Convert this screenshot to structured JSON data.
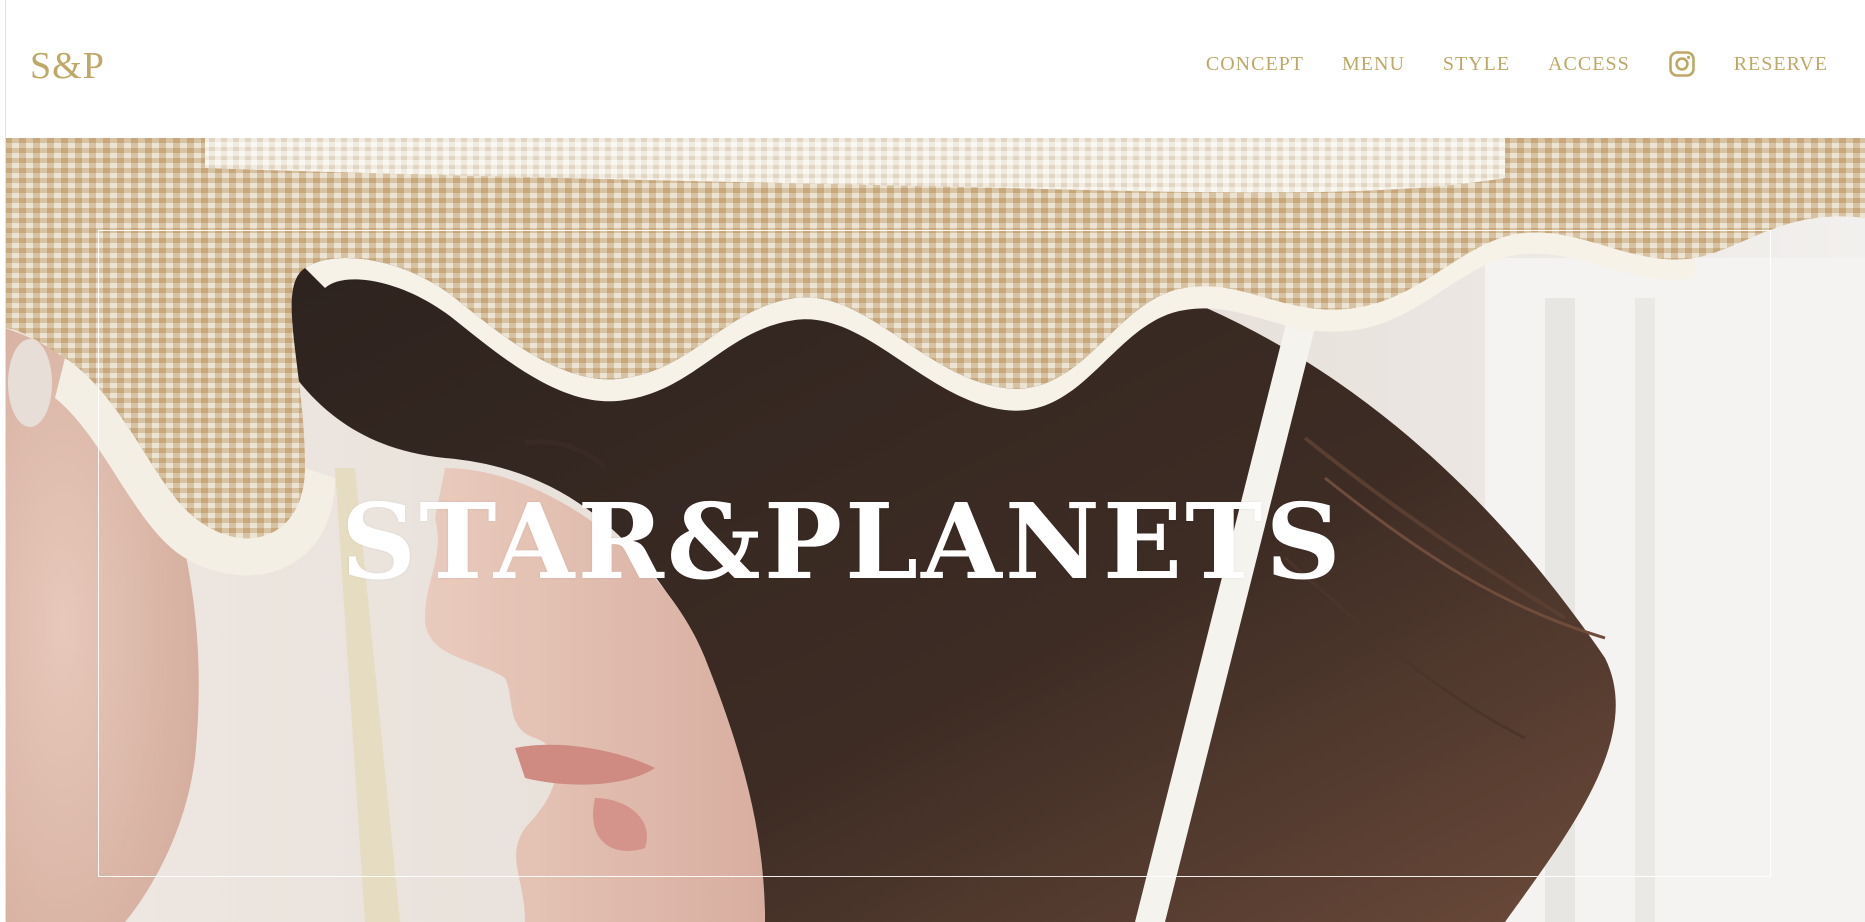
{
  "header": {
    "logo": "S&P",
    "nav": {
      "concept": "CONCEPT",
      "menu": "MENU",
      "style": "STYLE",
      "access": "ACCESS",
      "instagram_icon": "instagram-icon",
      "reserve": "RESERVE"
    }
  },
  "hero": {
    "title": "STAR&PLANETS"
  },
  "colors": {
    "brand_gold": "#bfa866",
    "header_bg": "#ffffff",
    "hero_text": "#ffffff"
  }
}
